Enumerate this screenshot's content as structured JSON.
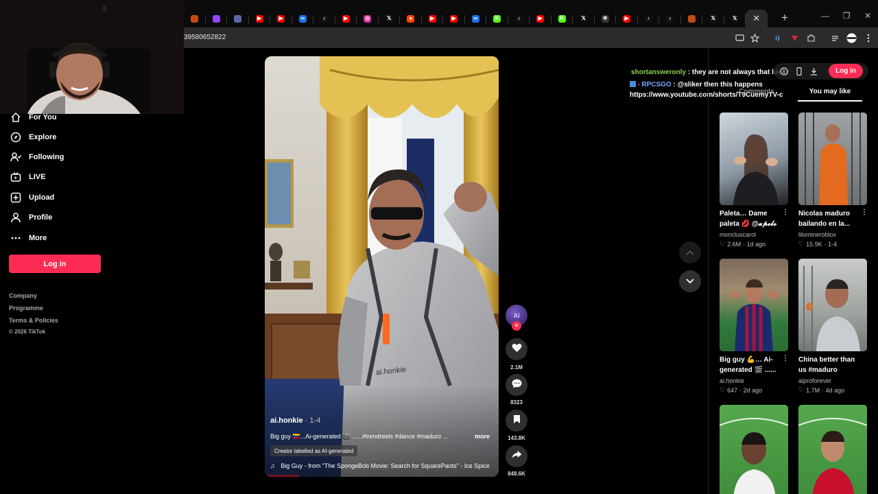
{
  "browser": {
    "tabs": [
      {
        "icon": "tab-favicon",
        "color": "#c34a12",
        "glyph": ""
      },
      {
        "icon": "twitch-icon",
        "color": "#9146ff",
        "glyph": ""
      },
      {
        "icon": "tab-favicon",
        "color": "#5a6aa8",
        "glyph": ""
      },
      {
        "icon": "youtube-icon",
        "color": "#ff0000",
        "glyph": "▶"
      },
      {
        "icon": "youtube-icon",
        "color": "#ff0000",
        "glyph": "▶"
      },
      {
        "icon": "tab-favicon",
        "color": "#1a73e8",
        "glyph": "∞"
      },
      {
        "icon": "tiktok-icon",
        "color": "#111111",
        "glyph": "♪"
      },
      {
        "icon": "youtube-icon",
        "color": "#ff0000",
        "glyph": "▶"
      },
      {
        "icon": "instagram-icon",
        "color": "#d6249f",
        "glyph": "◎"
      },
      {
        "icon": "x-icon",
        "color": "#111111",
        "glyph": "𝕏"
      },
      {
        "icon": "reddit-icon",
        "color": "#ff4500",
        "glyph": "●"
      },
      {
        "icon": "youtube-icon",
        "color": "#ff0000",
        "glyph": "▶"
      },
      {
        "icon": "youtube-icon",
        "color": "#ff0000",
        "glyph": "▶"
      },
      {
        "icon": "tab-favicon",
        "color": "#1a73e8",
        "glyph": "∞"
      },
      {
        "icon": "kick-icon",
        "color": "#53fc18",
        "glyph": "K"
      },
      {
        "icon": "tiktok-icon",
        "color": "#111111",
        "glyph": "♪"
      },
      {
        "icon": "youtube-icon",
        "color": "#ff0000",
        "glyph": "▶"
      },
      {
        "icon": "kick-icon",
        "color": "#53fc18",
        "glyph": "K"
      },
      {
        "icon": "x-icon",
        "color": "#111111",
        "glyph": "𝕏"
      },
      {
        "icon": "chatgpt-icon",
        "color": "#333333",
        "glyph": "✲"
      },
      {
        "icon": "youtube-icon",
        "color": "#ff0000",
        "glyph": "▶"
      },
      {
        "icon": "tiktok-icon",
        "color": "#111111",
        "glyph": "♪"
      },
      {
        "icon": "tiktok-icon",
        "color": "#111111",
        "glyph": "♪"
      },
      {
        "icon": "tab-favicon",
        "color": "#c34a12",
        "glyph": ""
      },
      {
        "icon": "x-icon",
        "color": "#111111",
        "glyph": "𝕏"
      },
      {
        "icon": "x-icon",
        "color": "#111111",
        "glyph": "𝕏"
      }
    ],
    "url": "39580652822"
  },
  "nav": {
    "items": [
      {
        "label": "For You",
        "icon": "home-icon"
      },
      {
        "label": "Explore",
        "icon": "compass-icon"
      },
      {
        "label": "Following",
        "icon": "following-icon"
      },
      {
        "label": "LIVE",
        "icon": "live-icon"
      },
      {
        "label": "Upload",
        "icon": "upload-icon"
      },
      {
        "label": "Profile",
        "icon": "profile-icon"
      },
      {
        "label": "More",
        "icon": "more-icon"
      }
    ],
    "login_label": "Log in",
    "footer": {
      "company": "Company",
      "programme": "Programme",
      "terms": "Terms & Policies",
      "copyright": "© 2026 TikTok"
    }
  },
  "video": {
    "author": "ai.honkie",
    "date": "· 1-4",
    "description": "Big guy 🇻🇪...Ai-generated 🎬 ......#trendreels #dance #maduro ...",
    "more_label": "more",
    "ai_label": "Creator labelled as AI-generated",
    "music": "Big Guy - from \"The SpongeBob Movie: Search for SquarePants\" - Ice Spice",
    "watermark": "ai.honkie",
    "avatar_text": "AI"
  },
  "actions": {
    "likes": "2.1M",
    "comments": "8323",
    "saves": "143.8K",
    "shares": "848.6K"
  },
  "chat": {
    "line1_user": "shortansweronly",
    "line1_text": ": they are not always that lucky",
    "line2_user": "RPCSGO",
    "line2_text": ": @sliker then this happens",
    "line3_text": "https://www.youtube.com/shorts/T9CuemyTV-c"
  },
  "right_panel": {
    "login_label": "Log in",
    "tab_comments": "Comments",
    "tab_you_may_like": "You may like",
    "cards": [
      {
        "title": "Paleta… Dame paleta 💋 @𝓪𝓹𝓸𝓵𝓸",
        "author": "moncluscarol",
        "likes": "2.6M",
        "date": "· 1d ago"
      },
      {
        "title": "Nicolas maduro bailando en la...",
        "author": "lilomineroblox",
        "likes": "15.9K",
        "date": "· 1-4"
      },
      {
        "title": "Big guy 💪… Ai-generated 🎬 ......",
        "author": "ai.honkie",
        "likes": "647",
        "date": "· 2d ago"
      },
      {
        "title": "China better than us #maduro",
        "author": "aiproforever",
        "likes": "1.7M",
        "date": "· 4d ago"
      },
      {
        "title": "",
        "author": "",
        "likes": "",
        "date": ""
      },
      {
        "title": "",
        "author": "",
        "likes": "",
        "date": ""
      }
    ]
  },
  "colors": {
    "accent": "#fe2c55",
    "chat_user1": "#8fd14f",
    "chat_user2": "#7aa7ff"
  }
}
